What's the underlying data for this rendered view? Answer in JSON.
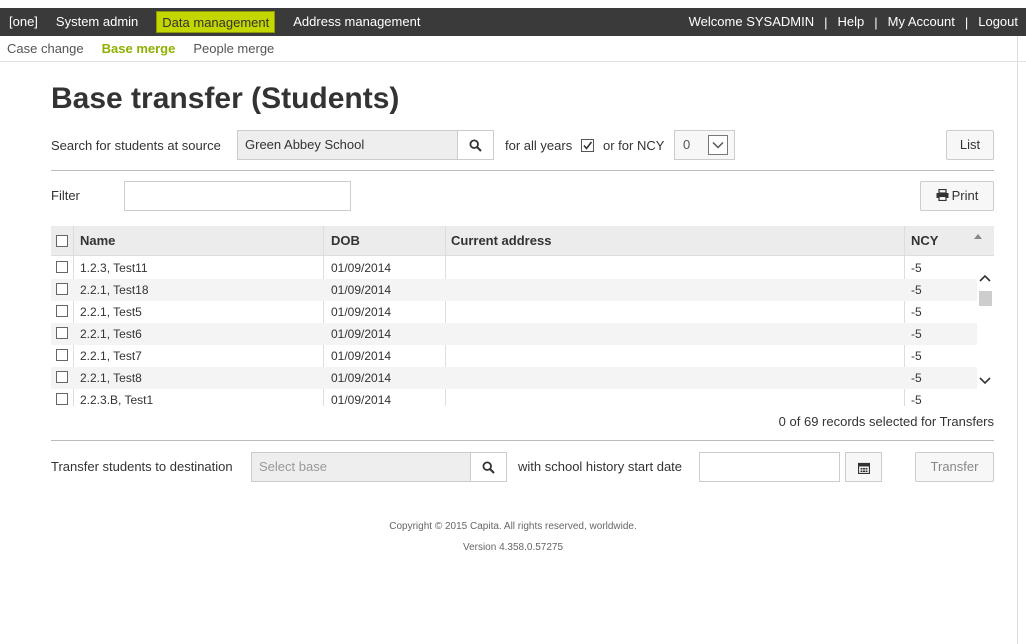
{
  "topnav": {
    "left": [
      "[one]",
      "System admin",
      "Data management",
      "Address management"
    ],
    "active": "Data management",
    "right": [
      "Welcome SYSADMIN",
      "Help",
      "My Account",
      "Logout"
    ],
    "separator": "|"
  },
  "subnav": {
    "items": [
      "Case change",
      "Base merge",
      "People merge"
    ],
    "active": "Base merge"
  },
  "page": {
    "title": "Base transfer (Students)"
  },
  "search": {
    "label": "Search for students at source",
    "value": "Green Abbey School",
    "all_years_label": "for all years",
    "all_years_checked": true,
    "ncy_label": "or for NCY",
    "ncy_value": "0",
    "list_label": "List"
  },
  "filter": {
    "label": "Filter",
    "value": "",
    "print_label": "Print"
  },
  "table": {
    "columns": [
      "Name",
      "DOB",
      "Current address",
      "NCY"
    ],
    "rows": [
      {
        "name": "1.2.3, Test11",
        "dob": "01/09/2014",
        "address": "",
        "ncy": "-5"
      },
      {
        "name": "2.2.1, Test18",
        "dob": "01/09/2014",
        "address": "",
        "ncy": "-5"
      },
      {
        "name": "2.2.1, Test5",
        "dob": "01/09/2014",
        "address": "",
        "ncy": "-5"
      },
      {
        "name": "2.2.1, Test6",
        "dob": "01/09/2014",
        "address": "",
        "ncy": "-5"
      },
      {
        "name": "2.2.1, Test7",
        "dob": "01/09/2014",
        "address": "",
        "ncy": "-5"
      },
      {
        "name": "2.2.1, Test8",
        "dob": "01/09/2014",
        "address": "",
        "ncy": "-5"
      },
      {
        "name": "2.2.3.B, Test1",
        "dob": "01/09/2014",
        "address": "",
        "ncy": "-5"
      }
    ],
    "records_text": "0 of 69 records selected for Transfers"
  },
  "transfer": {
    "label": "Transfer students to destination",
    "base_placeholder": "Select base",
    "date_label": "with school history start date",
    "date_value": "",
    "button_label": "Transfer"
  },
  "footer": {
    "copyright": "Copyright © 2015 Capita. All rights reserved, worldwide.",
    "version": "Version 4.358.0.57275"
  },
  "colors": {
    "accent": "#c3d600",
    "subnav_active": "#8eb100",
    "topbar": "#3a3a3a"
  }
}
